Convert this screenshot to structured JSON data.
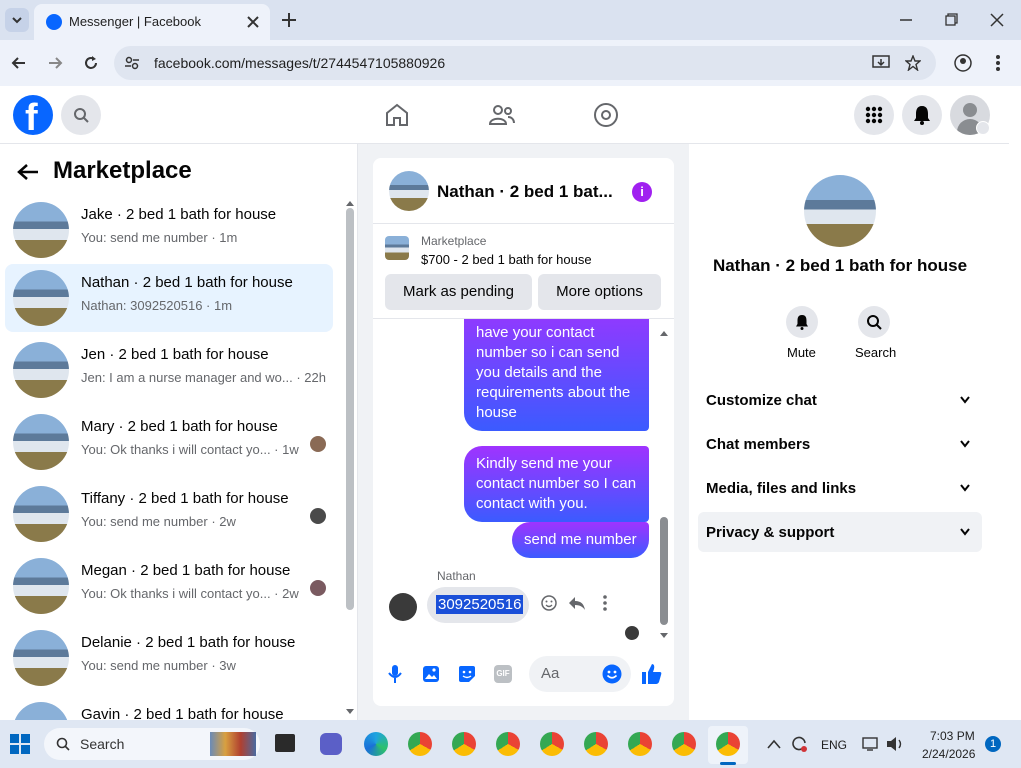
{
  "browser": {
    "tab_title": "Messenger | Facebook",
    "url": "facebook.com/messages/t/2744547105880926"
  },
  "left": {
    "title": "Marketplace",
    "conversations": [
      {
        "title": "Jake · 2 bed 1 bath for house",
        "sub": "You: send me number · 1m"
      },
      {
        "title": "Nathan · 2 bed 1 bath for house",
        "sub": "Nathan: 3092520516 · 1m"
      },
      {
        "title": "Jen · 2 bed 1 bath for house",
        "sub": "Jen: I am a nurse manager and wo... · 22h"
      },
      {
        "title": "Mary · 2 bed 1 bath for house",
        "sub": "You: Ok thanks i will contact yo... · 1w"
      },
      {
        "title": "Tiffany · 2 bed 1 bath for house",
        "sub": "You: send me number · 2w"
      },
      {
        "title": "Megan · 2 bed 1 bath for house",
        "sub": "You: Ok thanks i will contact yo... · 2w"
      },
      {
        "title": "Delanie · 2 bed 1 bath for house",
        "sub": "You: send me number · 3w"
      },
      {
        "title": "Gavin · 2 bed 1 bath for house",
        "sub": ""
      }
    ]
  },
  "chat": {
    "header_title": "Nathan · 2 bed 1 bat...",
    "listing_label": "Marketplace",
    "listing_title": "$700 - 2 bed 1 bath for house",
    "mark_pending": "Mark as pending",
    "more_options": "More options",
    "messages": [
      {
        "from": "me",
        "text": "available for rent, let me have your contact number so i can send you details and the requirements about the house"
      },
      {
        "from": "me",
        "text": "Kindly send me your contact number so I can contact with you."
      },
      {
        "from": "me",
        "text": "send me number"
      }
    ],
    "sender_name": "Nathan",
    "received_text": "3092520516",
    "input_placeholder": "Aa"
  },
  "info": {
    "title": "Nathan · 2 bed 1 bath for house",
    "mute": "Mute",
    "search": "Search",
    "sections": [
      "Customize chat",
      "Chat members",
      "Media, files and links",
      "Privacy & support"
    ]
  },
  "taskbar": {
    "search": "Search",
    "lang": "ENG",
    "time": "7:03 PM",
    "date": "2/24/2026",
    "notif": "1"
  },
  "colors": {
    "fb_blue": "#0866ff",
    "active_row": "#e7f3ff",
    "bubble_start": "#a033ff",
    "bubble_end": "#3b5bff"
  }
}
